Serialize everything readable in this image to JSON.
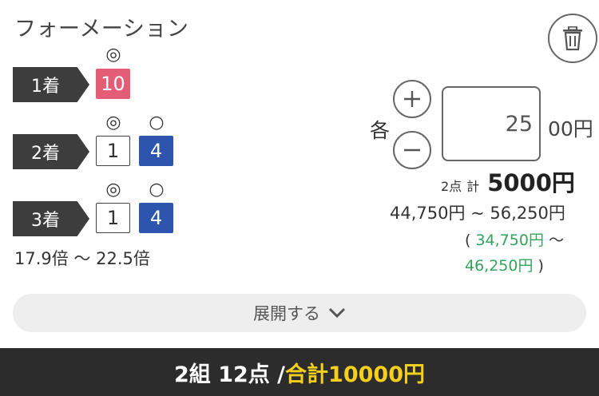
{
  "title": "フォーメーション",
  "icons": {
    "trash": "trash-icon",
    "plus": "plus-icon",
    "minus": "minus-icon",
    "chevron": "chevron-down-icon"
  },
  "colors": {
    "place_tag": "#3d3d3d",
    "pink": "#e35d77",
    "blue": "#2e55ad",
    "green": "#34a35c",
    "yellow": "#f4cf1c",
    "footer_bg": "#2c2c2c"
  },
  "places": [
    {
      "label": "1着",
      "marks": [
        "◎"
      ],
      "numbers": [
        {
          "value": "10",
          "style": "pink"
        }
      ]
    },
    {
      "label": "2着",
      "marks": [
        "◎",
        "○"
      ],
      "numbers": [
        {
          "value": "1",
          "style": "white"
        },
        {
          "value": "4",
          "style": "blue"
        }
      ]
    },
    {
      "label": "3着",
      "marks": [
        "◎",
        "○"
      ],
      "numbers": [
        {
          "value": "1",
          "style": "white"
        },
        {
          "value": "4",
          "style": "blue"
        }
      ]
    }
  ],
  "odds_range": "17.9倍 〜 22.5倍",
  "bet": {
    "each_label": "各",
    "amount_value": "25",
    "amount_suffix": "00円",
    "points_label": "2点",
    "total_label": "計",
    "total_amount": "5000円",
    "payout_range": "44,750円 ~ 56,250円",
    "paren_open": "(",
    "sub_low": "34,750円",
    "sub_sep": "〜",
    "sub_high": "46,250円",
    "paren_close": ")"
  },
  "expand_label": "展開する",
  "footer": {
    "summary": "2組 12点 /",
    "total": "合計10000円"
  }
}
